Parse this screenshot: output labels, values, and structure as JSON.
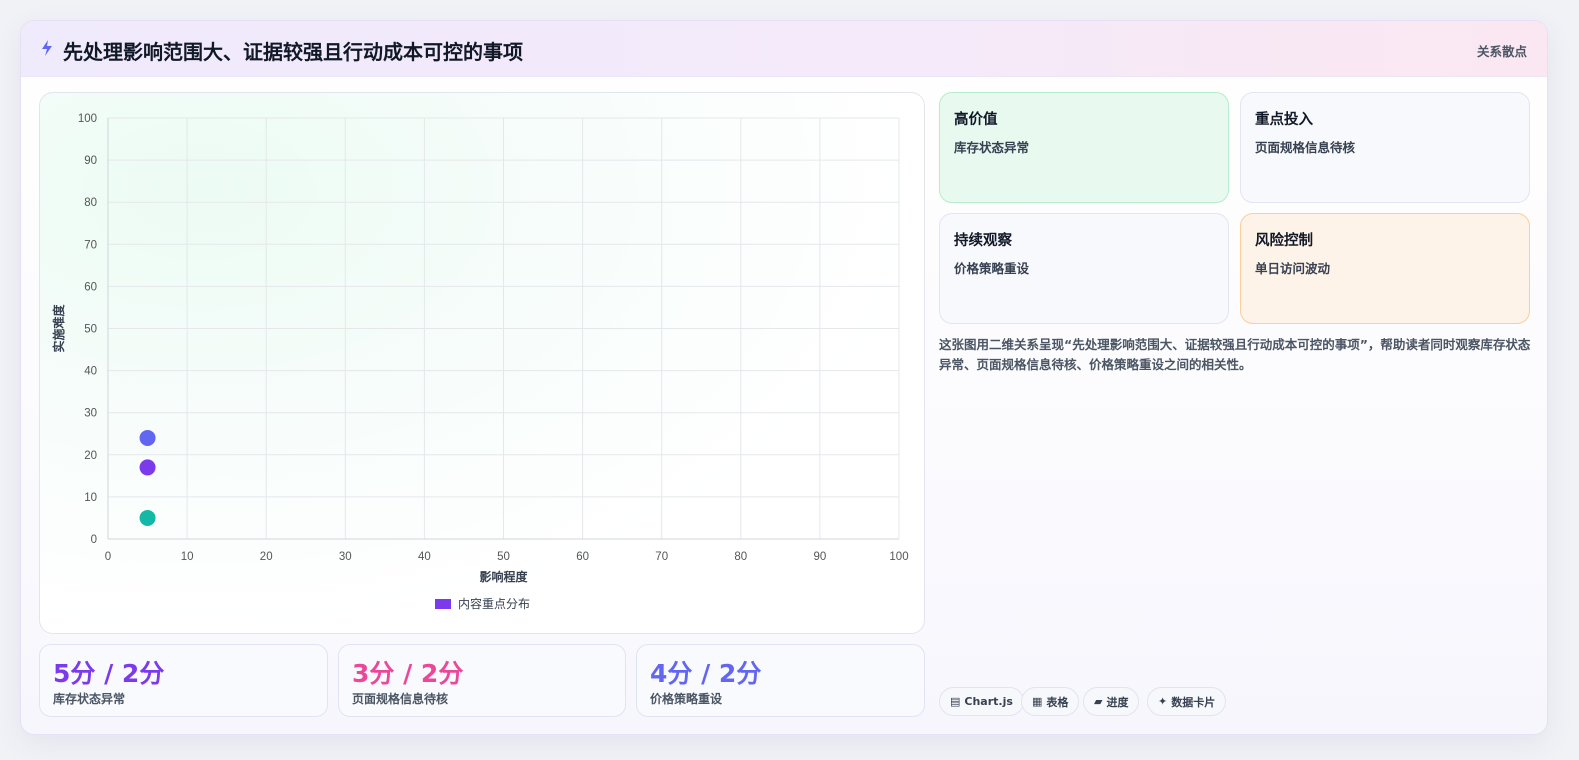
{
  "header": {
    "title": "先处理影响范围大、证据较强且行动成本可控的事项",
    "tag": "关系散点"
  },
  "chart_data": {
    "type": "scatter",
    "xlabel": "影响程度",
    "ylabel": "实施难度",
    "xlim": [
      0,
      100
    ],
    "ylim": [
      0,
      100
    ],
    "xticks": [
      0,
      10,
      20,
      30,
      40,
      50,
      60,
      70,
      80,
      90,
      100
    ],
    "yticks": [
      0,
      10,
      20,
      30,
      40,
      50,
      60,
      70,
      80,
      90,
      100
    ],
    "grid": true,
    "legend": {
      "position": "bottom",
      "label": "内容重点分布",
      "color": "#7c3aed"
    },
    "points": [
      {
        "x": 5,
        "y": 24,
        "color": "#6366f1"
      },
      {
        "x": 5,
        "y": 17,
        "color": "#7c3aed"
      },
      {
        "x": 5,
        "y": 5,
        "color": "#14b8a6"
      }
    ]
  },
  "stats": [
    {
      "value": "5分 / 2分",
      "label": "库存状态异常",
      "color": "#7c3aed"
    },
    {
      "value": "3分 / 2分",
      "label": "页面规格信息待核",
      "color": "#ec4899"
    },
    {
      "value": "4分 / 2分",
      "label": "价格策略重设",
      "color": "#6366f1"
    }
  ],
  "quadrants": [
    {
      "title": "高价值",
      "item": "库存状态异常"
    },
    {
      "title": "重点投入",
      "item": "页面规格信息待核"
    },
    {
      "title": "持续观察",
      "item": "价格策略重设"
    },
    {
      "title": "风险控制",
      "item": "单日访问波动"
    }
  ],
  "description": "这张图用二维关系呈现“先处理影响范围大、证据较强且行动成本可控的事项”，帮助读者同时观察库存状态异常、页面规格信息待核、价格策略重设之间的相关性。",
  "chips": [
    {
      "icon": "chart-icon",
      "glyph": "▤",
      "label": "Chart.js"
    },
    {
      "icon": "table-icon",
      "glyph": "▦",
      "label": "表格"
    },
    {
      "icon": "progress-icon",
      "glyph": "▰",
      "label": "进度"
    },
    {
      "icon": "sparkle-icon",
      "glyph": "✦",
      "label": "数据卡片"
    }
  ],
  "colors": {
    "accent": "#7c3aed",
    "bolt": "#6366f1"
  }
}
